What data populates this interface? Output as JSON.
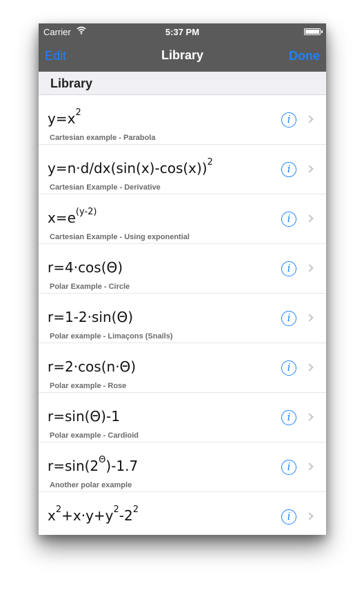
{
  "status_bar": {
    "carrier": "Carrier",
    "wifi_icon": "wifi-icon",
    "time": "5:37 PM",
    "battery_icon": "battery-icon"
  },
  "nav": {
    "edit_label": "Edit",
    "title": "Library",
    "done_label": "Done"
  },
  "section": {
    "title": "Library"
  },
  "accent_color": "#1a84ff",
  "rows": [
    {
      "formula_html": "y=x<sup>2</sup>",
      "desc": "Cartesian example - Parabola"
    },
    {
      "formula_html": "y=n·d/dx(sin(x)-cos(x))<sup>2</sup>",
      "desc": "Cartesian Example - Derivative"
    },
    {
      "formula_html": "x=e<sup>(y-2)</sup>",
      "desc": "Cartesian Example - Using exponential"
    },
    {
      "formula_html": "r=4·cos(Θ)",
      "desc": "Polar Example - Circle"
    },
    {
      "formula_html": "r=1-2·sin(Θ)",
      "desc": "Polar example - Limaçons (Snails)"
    },
    {
      "formula_html": "r=2·cos(n·Θ)",
      "desc": "Polar example - Rose"
    },
    {
      "formula_html": "r=sin(Θ)-1",
      "desc": "Polar example - Cardioid"
    },
    {
      "formula_html": "r=sin(2<sup>Θ</sup>)-1.7",
      "desc": "Another polar example"
    },
    {
      "formula_html": "x<sup>2</sup>+x·y+y<sup>2</sup>-2<sup>2</sup>",
      "desc": ""
    }
  ]
}
